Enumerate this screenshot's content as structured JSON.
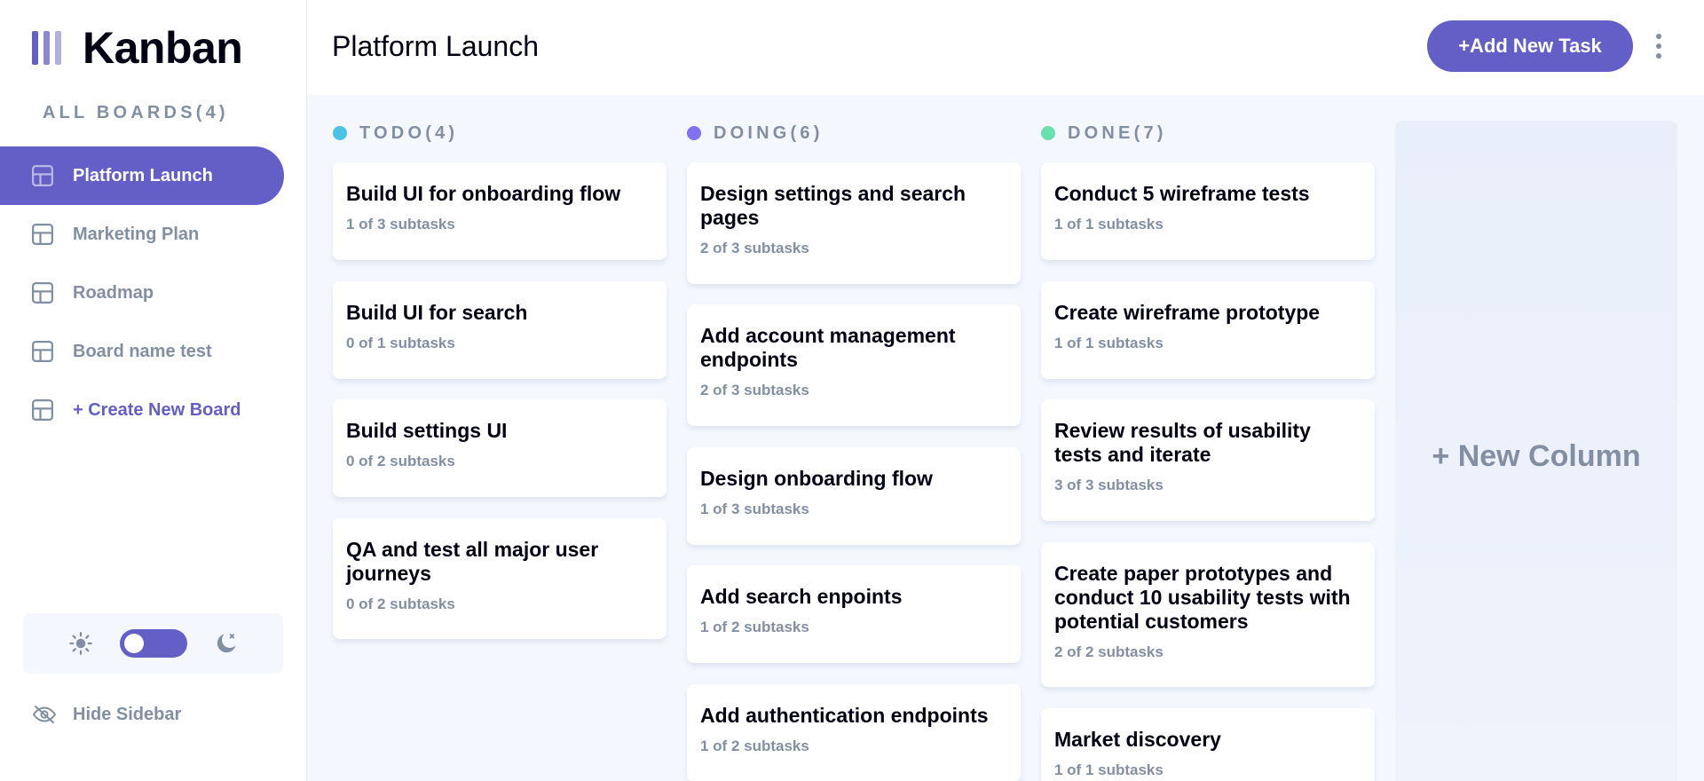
{
  "app": {
    "name": "Kanban"
  },
  "sidebar": {
    "all_boards_label": "ALL BOARDS(4)",
    "boards": [
      {
        "label": "Platform Launch",
        "active": true
      },
      {
        "label": "Marketing Plan",
        "active": false
      },
      {
        "label": "Roadmap",
        "active": false
      },
      {
        "label": "Board name test",
        "active": false
      }
    ],
    "create_board_label": "+ Create New Board",
    "theme_toggle": {
      "light_icon": "sun-icon",
      "dark_icon": "moon-icon",
      "state": "light"
    },
    "hide_sidebar_label": "Hide Sidebar",
    "hide_sidebar_icon": "eye-slash-icon"
  },
  "header": {
    "title": "Platform Launch",
    "add_task_label": "+Add New Task",
    "menu_icon": "vertical-ellipsis-icon"
  },
  "columns": [
    {
      "title": "TODO(4)",
      "color": "#49c4e5",
      "tasks": [
        {
          "title": "Build UI for onboarding flow",
          "subtasks": "1 of 3 subtasks"
        },
        {
          "title": "Build UI for search",
          "subtasks": "0 of 1 subtasks"
        },
        {
          "title": "Build settings UI",
          "subtasks": "0 of 2 subtasks"
        },
        {
          "title": "QA and test all major user journeys",
          "subtasks": "0 of 2 subtasks"
        }
      ]
    },
    {
      "title": "DOING(6)",
      "color": "#8471f2",
      "tasks": [
        {
          "title": "Design settings and search pages",
          "subtasks": "2 of 3 subtasks"
        },
        {
          "title": "Add account management endpoints",
          "subtasks": "2 of 3 subtasks"
        },
        {
          "title": "Design onboarding flow",
          "subtasks": "1 of 3 subtasks"
        },
        {
          "title": "Add search enpoints",
          "subtasks": "1 of 2 subtasks"
        },
        {
          "title": "Add authentication endpoints",
          "subtasks": "1 of 2 subtasks"
        }
      ]
    },
    {
      "title": "DONE(7)",
      "color": "#67e2ae",
      "tasks": [
        {
          "title": "Conduct 5 wireframe tests",
          "subtasks": "1 of 1 subtasks"
        },
        {
          "title": "Create wireframe prototype",
          "subtasks": "1 of 1 subtasks"
        },
        {
          "title": "Review results of usability tests and iterate",
          "subtasks": "3 of 3 subtasks"
        },
        {
          "title": "Create paper prototypes and conduct 10 usability tests with potential customers",
          "subtasks": "2 of 2 subtasks"
        },
        {
          "title": "Market discovery",
          "subtasks": "1 of 1 subtasks"
        }
      ]
    }
  ],
  "new_column_label": "+ New Column",
  "colors": {
    "accent": "#635fc7",
    "muted": "#828fa3",
    "background": "#f4f7fd"
  }
}
